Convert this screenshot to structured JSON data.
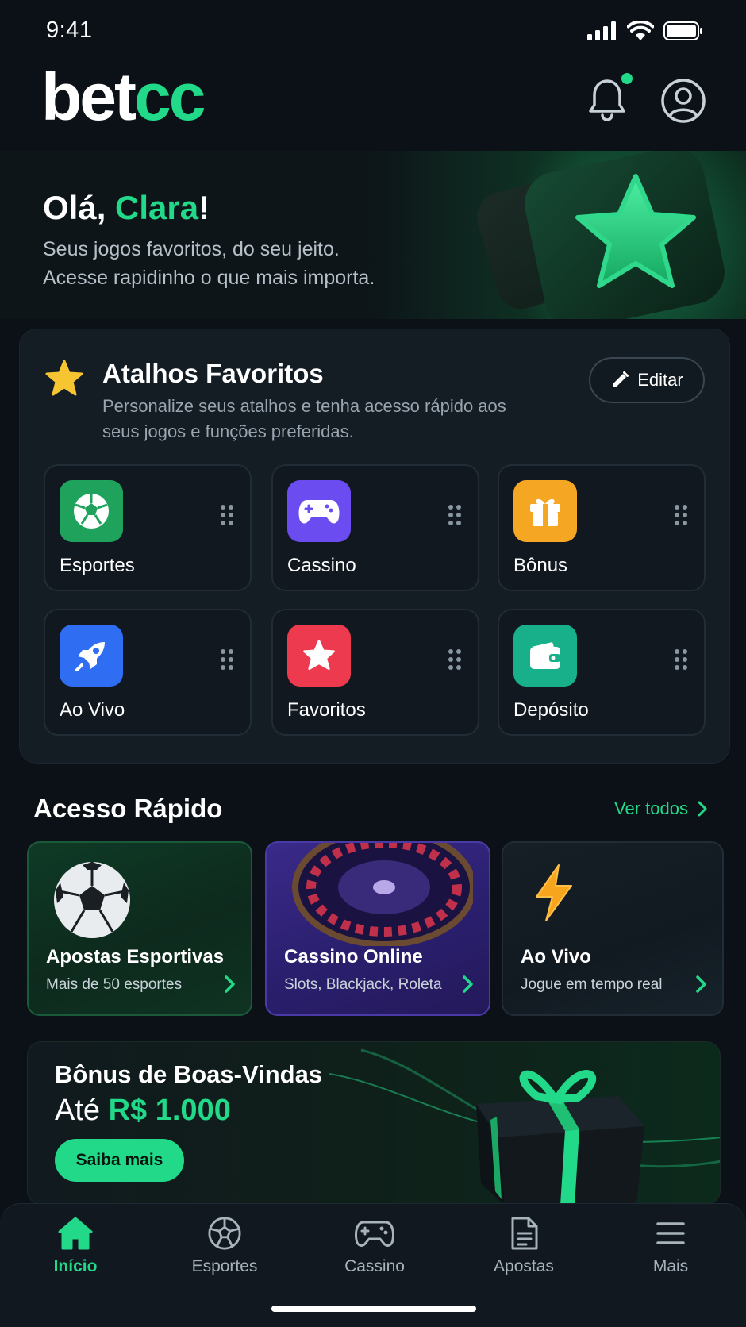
{
  "status_bar": {
    "time": "9:41"
  },
  "header": {
    "logo_white": "bet",
    "logo_green": "cc"
  },
  "hero": {
    "greeting_prefix": "Olá, ",
    "name": "Clara",
    "greeting_suffix": "!",
    "line1": "Seus jogos favoritos, do seu jeito.",
    "line2": "Acesse rapidinho o que mais importa."
  },
  "favorites": {
    "title": "Atalhos Favoritos",
    "description": "Personalize seus atalhos e tenha acesso rápido aos seus jogos e funções preferidas.",
    "edit_label": "Editar",
    "tiles": [
      {
        "label": "Esportes",
        "icon": "soccer-ball-icon",
        "color": "#1fa35c"
      },
      {
        "label": "Cassino",
        "icon": "gamepad-icon",
        "color": "#6a4cf0"
      },
      {
        "label": "Bônus",
        "icon": "gift-icon",
        "color": "#f5a623"
      },
      {
        "label": "Ao Vivo",
        "icon": "rocket-icon",
        "color": "#2f6df2"
      },
      {
        "label": "Favoritos",
        "icon": "star-icon",
        "color": "#ee3a4f"
      },
      {
        "label": "Depósito",
        "icon": "wallet-icon",
        "color": "#17b08a"
      }
    ]
  },
  "quick_access": {
    "title": "Acesso Rápido",
    "see_all": "Ver todos",
    "cards": [
      {
        "title": "Apostas Esportivas",
        "subtitle": "Mais de 50 esportes"
      },
      {
        "title": "Cassino Online",
        "subtitle": "Slots, Blackjack, Roleta"
      },
      {
        "title": "Ao Vivo",
        "subtitle": "Jogue em tempo real"
      }
    ]
  },
  "bonus": {
    "title": "Bônus de Boas-Vindas",
    "prefix": "Até ",
    "amount": "R$ 1.000",
    "button": "Saiba mais"
  },
  "bottom_nav": {
    "items": [
      {
        "label": "Início",
        "icon": "home-icon",
        "active": true
      },
      {
        "label": "Esportes",
        "icon": "soccer-ball-icon",
        "active": false
      },
      {
        "label": "Cassino",
        "icon": "gamepad-icon",
        "active": false
      },
      {
        "label": "Apostas",
        "icon": "document-icon",
        "active": false
      },
      {
        "label": "Mais",
        "icon": "menu-icon",
        "active": false
      }
    ]
  },
  "colors": {
    "accent": "#22d98a",
    "background": "#0b1117",
    "card": "#141c24"
  }
}
